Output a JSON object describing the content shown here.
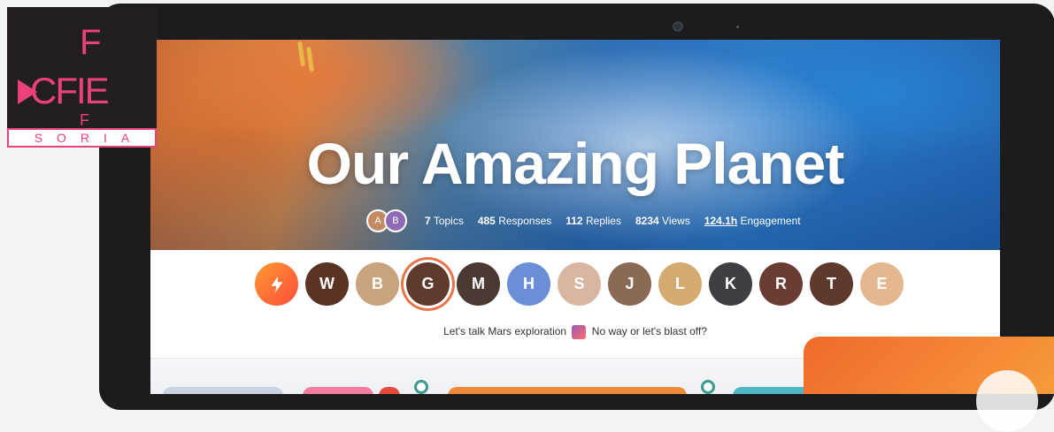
{
  "logo": {
    "main": "CFIE",
    "top_letter": "F",
    "bottom_letter": "F",
    "subtitle": "SORIA"
  },
  "hero": {
    "title": "Our Amazing Planet",
    "contributors": [
      {
        "name": "contributor-1",
        "initials": "A",
        "color": "#c48b62"
      },
      {
        "name": "contributor-2",
        "initials": "B",
        "color": "#8e6ab7"
      }
    ],
    "stats": [
      {
        "value": "7",
        "label": "Topics"
      },
      {
        "value": "485",
        "label": "Responses"
      },
      {
        "value": "112",
        "label": "Replies"
      },
      {
        "value": "8234",
        "label": "Views"
      },
      {
        "value": "124.1h",
        "label": "Engagement"
      }
    ]
  },
  "participants": {
    "lead_icon": "lightning-icon",
    "people": [
      {
        "initials": "",
        "color": "#ff6a3d",
        "active": false
      },
      {
        "initials": "W",
        "color": "#5a3324",
        "active": false
      },
      {
        "initials": "B",
        "color": "#c9a27e",
        "active": false
      },
      {
        "initials": "G",
        "color": "#5f3b2d",
        "active": true
      },
      {
        "initials": "M",
        "color": "#4a3a32",
        "active": false
      },
      {
        "initials": "H",
        "color": "#6b8fd6",
        "active": false
      },
      {
        "initials": "S",
        "color": "#d9b6a1",
        "active": false
      },
      {
        "initials": "J",
        "color": "#8a6a54",
        "active": false
      },
      {
        "initials": "L",
        "color": "#d5aa70",
        "active": false
      },
      {
        "initials": "K",
        "color": "#3e3e44",
        "active": false
      },
      {
        "initials": "R",
        "color": "#6a3c34",
        "active": false
      },
      {
        "initials": "T",
        "color": "#5d3a2c",
        "active": false
      },
      {
        "initials": "E",
        "color": "#e3b78f",
        "active": false
      }
    ]
  },
  "prompt": {
    "before": "Let's talk Mars exploration",
    "icon": "rocket-icon",
    "after": "No way or let's blast off?"
  }
}
